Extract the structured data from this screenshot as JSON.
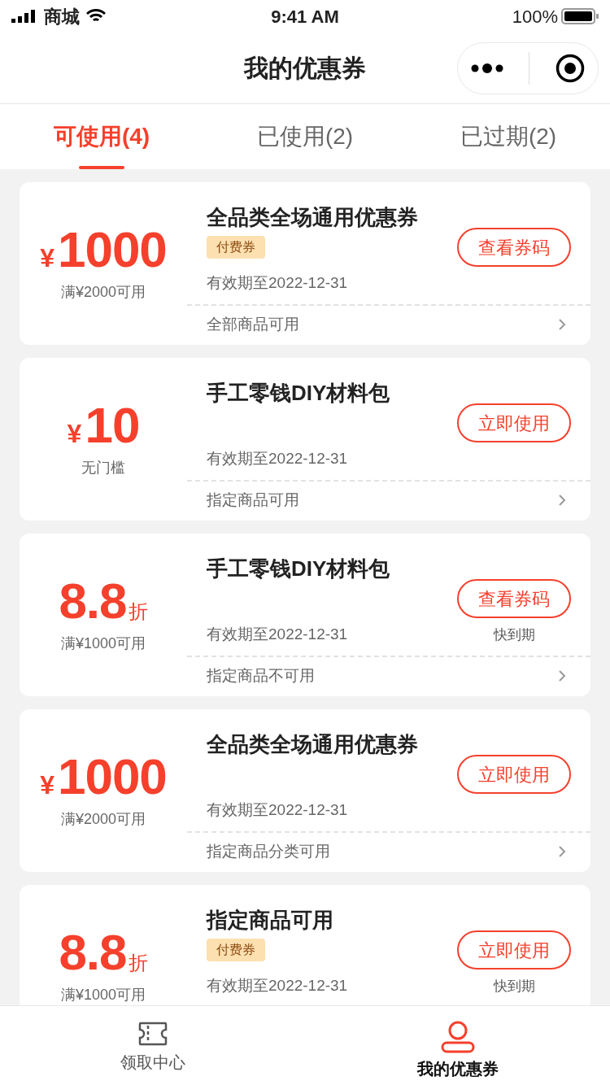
{
  "status_bar": {
    "carrier": "商城",
    "time": "9:41 AM",
    "battery": "100%"
  },
  "nav": {
    "title": "我的优惠券"
  },
  "tabs": [
    {
      "label": "可使用(4)",
      "selected": true
    },
    {
      "label": "已使用(2)",
      "selected": false
    },
    {
      "label": "已过期(2)",
      "selected": false
    }
  ],
  "coupons": [
    {
      "kind": "cash",
      "currency": "¥",
      "amount": "1000",
      "condition": "满¥2000可用",
      "title": "全品类全场通用优惠券",
      "badge": "付费券",
      "validity": "有效期至2022-12-31",
      "action": "查看券码",
      "scope": "全部商品可用"
    },
    {
      "kind": "cash",
      "currency": "¥",
      "amount": "10",
      "condition": "无门槛",
      "title": "手工零钱DIY材料包",
      "validity": "有效期至2022-12-31",
      "action": "立即使用",
      "scope": "指定商品可用"
    },
    {
      "kind": "discount",
      "amount": "8.8",
      "unit": "折",
      "condition": "满¥1000可用",
      "title": "手工零钱DIY材料包",
      "validity": "有效期至2022-12-31",
      "action": "查看券码",
      "expiring": "快到期",
      "scope": "指定商品不可用"
    },
    {
      "kind": "cash",
      "currency": "¥",
      "amount": "1000",
      "condition": "满¥2000可用",
      "title": "全品类全场通用优惠券",
      "validity": "有效期至2022-12-31",
      "action": "立即使用",
      "scope": "指定商品分类可用"
    },
    {
      "kind": "discount",
      "amount": "8.8",
      "unit": "折",
      "condition": "满¥1000可用",
      "title": "指定商品可用",
      "badge": "付费券",
      "validity": "有效期至2022-12-31",
      "action": "立即使用",
      "expiring": "快到期"
    }
  ],
  "tab_bar": [
    {
      "kind": "ticket",
      "label": "领取中心",
      "selected": false
    },
    {
      "kind": "person",
      "label": "我的优惠券",
      "selected": true
    }
  ]
}
